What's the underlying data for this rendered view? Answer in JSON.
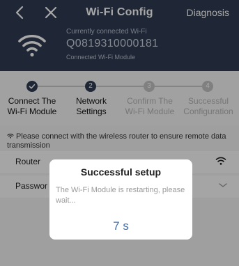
{
  "header": {
    "title": "Wi-Fi Config",
    "diagnosis_label": "Diagnosis",
    "background_color": "#2f3b51"
  },
  "connection": {
    "subtitle": "Currently connected Wi-Fi",
    "device_id": "Q0819310000181",
    "module_label": "Connected Wi-Fi Module",
    "icon": "wifi-icon"
  },
  "steps": [
    {
      "number": "",
      "line1": "Connect The",
      "line2": "Wi-Fi Module",
      "state": "completed"
    },
    {
      "number": "2",
      "line1": "Network",
      "line2": "Settings",
      "state": "current"
    },
    {
      "number": "3",
      "line1": "Confirm The",
      "line2": "Wi-Fi Module",
      "state": "pending"
    },
    {
      "number": "4",
      "line1": "Successful",
      "line2": "Configuration",
      "state": "pending"
    }
  ],
  "hint": {
    "text": "Please connect with the wireless router to ensure remote data transmission",
    "icon": "wifi-icon"
  },
  "form": {
    "router_label": "Router",
    "password_label": "Passwor"
  },
  "dialog": {
    "title": "Successful setup",
    "message": "The Wi-Fi Module is restarting, please wait...",
    "countdown": "7 s",
    "accent_color": "#3f6fb0"
  }
}
